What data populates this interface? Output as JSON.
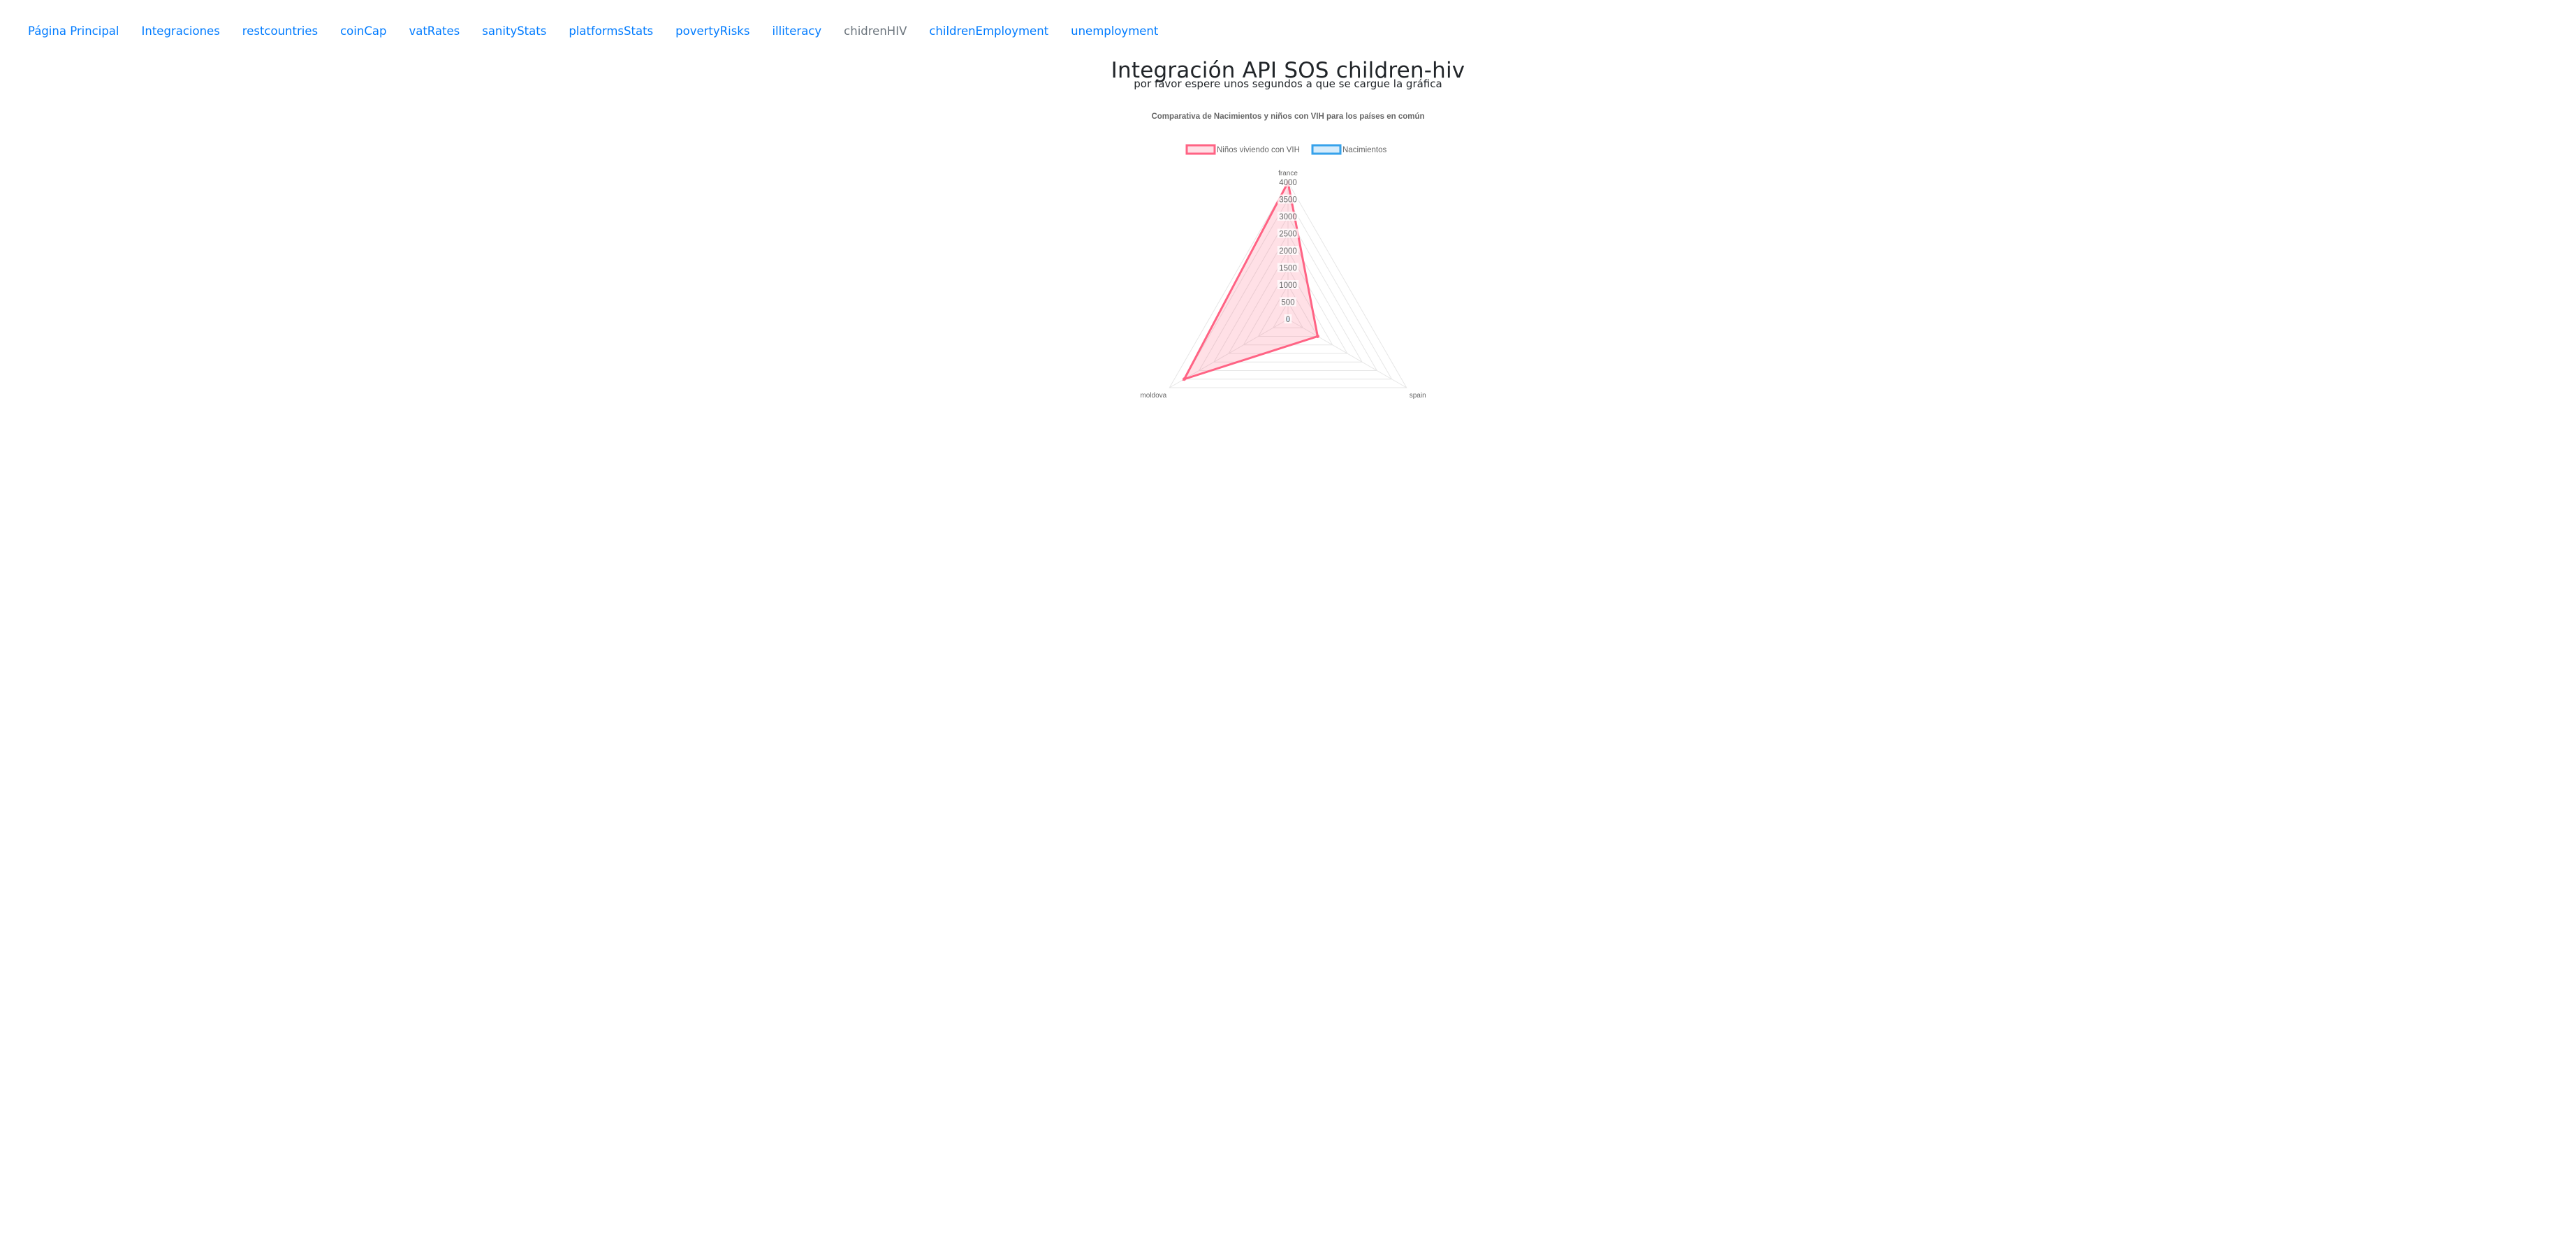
{
  "nav": {
    "items": [
      {
        "label": "Página Principal",
        "active": false
      },
      {
        "label": "Integraciones",
        "active": false
      },
      {
        "label": "restcountries",
        "active": false
      },
      {
        "label": "coinCap",
        "active": false
      },
      {
        "label": "vatRates",
        "active": false
      },
      {
        "label": "sanityStats",
        "active": false
      },
      {
        "label": "platformsStats",
        "active": false
      },
      {
        "label": "povertyRisks",
        "active": false
      },
      {
        "label": "illiteracy",
        "active": false
      },
      {
        "label": "chidrenHIV",
        "active": true
      },
      {
        "label": "childrenEmployment",
        "active": false
      },
      {
        "label": "unemployment",
        "active": false
      }
    ]
  },
  "page": {
    "title": "Integración API SOS children-hiv",
    "subtitle": "por favor espere unos segundos a que se cargue la gráfica"
  },
  "chart_data": {
    "type": "radar",
    "title": "Comparativa de Nacimientos y niños con VIH para los países en común",
    "categories": [
      "france",
      "spain",
      "moldova"
    ],
    "rlim": [
      0,
      4000
    ],
    "ticks": [
      0,
      500,
      1000,
      1500,
      2000,
      2500,
      3000,
      3500,
      4000
    ],
    "grid": true,
    "legend_position": "top",
    "series": [
      {
        "name": "Niños viviendo con VIH",
        "values": [
          4000,
          1000,
          3500
        ],
        "color": "#ff6384"
      },
      {
        "name": "Nacimientos",
        "values": [
          0,
          0,
          0
        ],
        "color": "#36a2eb"
      }
    ]
  }
}
